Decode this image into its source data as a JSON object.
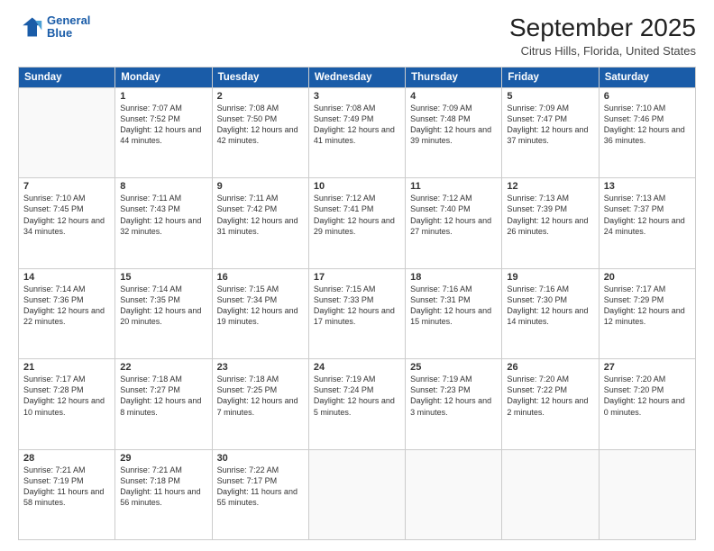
{
  "header": {
    "logo_line1": "General",
    "logo_line2": "Blue",
    "title": "September 2025",
    "subtitle": "Citrus Hills, Florida, United States"
  },
  "days_of_week": [
    "Sunday",
    "Monday",
    "Tuesday",
    "Wednesday",
    "Thursday",
    "Friday",
    "Saturday"
  ],
  "weeks": [
    [
      {
        "num": "",
        "info": ""
      },
      {
        "num": "1",
        "info": "Sunrise: 7:07 AM\nSunset: 7:52 PM\nDaylight: 12 hours\nand 44 minutes."
      },
      {
        "num": "2",
        "info": "Sunrise: 7:08 AM\nSunset: 7:50 PM\nDaylight: 12 hours\nand 42 minutes."
      },
      {
        "num": "3",
        "info": "Sunrise: 7:08 AM\nSunset: 7:49 PM\nDaylight: 12 hours\nand 41 minutes."
      },
      {
        "num": "4",
        "info": "Sunrise: 7:09 AM\nSunset: 7:48 PM\nDaylight: 12 hours\nand 39 minutes."
      },
      {
        "num": "5",
        "info": "Sunrise: 7:09 AM\nSunset: 7:47 PM\nDaylight: 12 hours\nand 37 minutes."
      },
      {
        "num": "6",
        "info": "Sunrise: 7:10 AM\nSunset: 7:46 PM\nDaylight: 12 hours\nand 36 minutes."
      }
    ],
    [
      {
        "num": "7",
        "info": "Sunrise: 7:10 AM\nSunset: 7:45 PM\nDaylight: 12 hours\nand 34 minutes."
      },
      {
        "num": "8",
        "info": "Sunrise: 7:11 AM\nSunset: 7:43 PM\nDaylight: 12 hours\nand 32 minutes."
      },
      {
        "num": "9",
        "info": "Sunrise: 7:11 AM\nSunset: 7:42 PM\nDaylight: 12 hours\nand 31 minutes."
      },
      {
        "num": "10",
        "info": "Sunrise: 7:12 AM\nSunset: 7:41 PM\nDaylight: 12 hours\nand 29 minutes."
      },
      {
        "num": "11",
        "info": "Sunrise: 7:12 AM\nSunset: 7:40 PM\nDaylight: 12 hours\nand 27 minutes."
      },
      {
        "num": "12",
        "info": "Sunrise: 7:13 AM\nSunset: 7:39 PM\nDaylight: 12 hours\nand 26 minutes."
      },
      {
        "num": "13",
        "info": "Sunrise: 7:13 AM\nSunset: 7:37 PM\nDaylight: 12 hours\nand 24 minutes."
      }
    ],
    [
      {
        "num": "14",
        "info": "Sunrise: 7:14 AM\nSunset: 7:36 PM\nDaylight: 12 hours\nand 22 minutes."
      },
      {
        "num": "15",
        "info": "Sunrise: 7:14 AM\nSunset: 7:35 PM\nDaylight: 12 hours\nand 20 minutes."
      },
      {
        "num": "16",
        "info": "Sunrise: 7:15 AM\nSunset: 7:34 PM\nDaylight: 12 hours\nand 19 minutes."
      },
      {
        "num": "17",
        "info": "Sunrise: 7:15 AM\nSunset: 7:33 PM\nDaylight: 12 hours\nand 17 minutes."
      },
      {
        "num": "18",
        "info": "Sunrise: 7:16 AM\nSunset: 7:31 PM\nDaylight: 12 hours\nand 15 minutes."
      },
      {
        "num": "19",
        "info": "Sunrise: 7:16 AM\nSunset: 7:30 PM\nDaylight: 12 hours\nand 14 minutes."
      },
      {
        "num": "20",
        "info": "Sunrise: 7:17 AM\nSunset: 7:29 PM\nDaylight: 12 hours\nand 12 minutes."
      }
    ],
    [
      {
        "num": "21",
        "info": "Sunrise: 7:17 AM\nSunset: 7:28 PM\nDaylight: 12 hours\nand 10 minutes."
      },
      {
        "num": "22",
        "info": "Sunrise: 7:18 AM\nSunset: 7:27 PM\nDaylight: 12 hours\nand 8 minutes."
      },
      {
        "num": "23",
        "info": "Sunrise: 7:18 AM\nSunset: 7:25 PM\nDaylight: 12 hours\nand 7 minutes."
      },
      {
        "num": "24",
        "info": "Sunrise: 7:19 AM\nSunset: 7:24 PM\nDaylight: 12 hours\nand 5 minutes."
      },
      {
        "num": "25",
        "info": "Sunrise: 7:19 AM\nSunset: 7:23 PM\nDaylight: 12 hours\nand 3 minutes."
      },
      {
        "num": "26",
        "info": "Sunrise: 7:20 AM\nSunset: 7:22 PM\nDaylight: 12 hours\nand 2 minutes."
      },
      {
        "num": "27",
        "info": "Sunrise: 7:20 AM\nSunset: 7:20 PM\nDaylight: 12 hours\nand 0 minutes."
      }
    ],
    [
      {
        "num": "28",
        "info": "Sunrise: 7:21 AM\nSunset: 7:19 PM\nDaylight: 11 hours\nand 58 minutes."
      },
      {
        "num": "29",
        "info": "Sunrise: 7:21 AM\nSunset: 7:18 PM\nDaylight: 11 hours\nand 56 minutes."
      },
      {
        "num": "30",
        "info": "Sunrise: 7:22 AM\nSunset: 7:17 PM\nDaylight: 11 hours\nand 55 minutes."
      },
      {
        "num": "",
        "info": ""
      },
      {
        "num": "",
        "info": ""
      },
      {
        "num": "",
        "info": ""
      },
      {
        "num": "",
        "info": ""
      }
    ]
  ]
}
